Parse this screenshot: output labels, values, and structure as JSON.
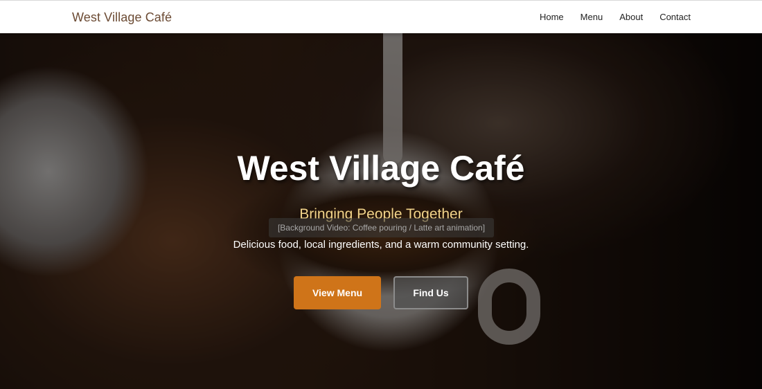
{
  "nav": {
    "brand": "West Village Café",
    "links": [
      "Home",
      "Menu",
      "About",
      "Contact"
    ]
  },
  "hero": {
    "title": "West Village Café",
    "tagline": "Bringing People Together",
    "video_placeholder": "[Background Video: Coffee pouring / Latte art animation]",
    "description": "Delicious food, local ingredients, and a warm community setting.",
    "primary_button": "View Menu",
    "secondary_button": "Find Us"
  },
  "colors": {
    "brand": "#6b4a33",
    "accent": "#cf7419",
    "tagline": "#f2d48a"
  }
}
